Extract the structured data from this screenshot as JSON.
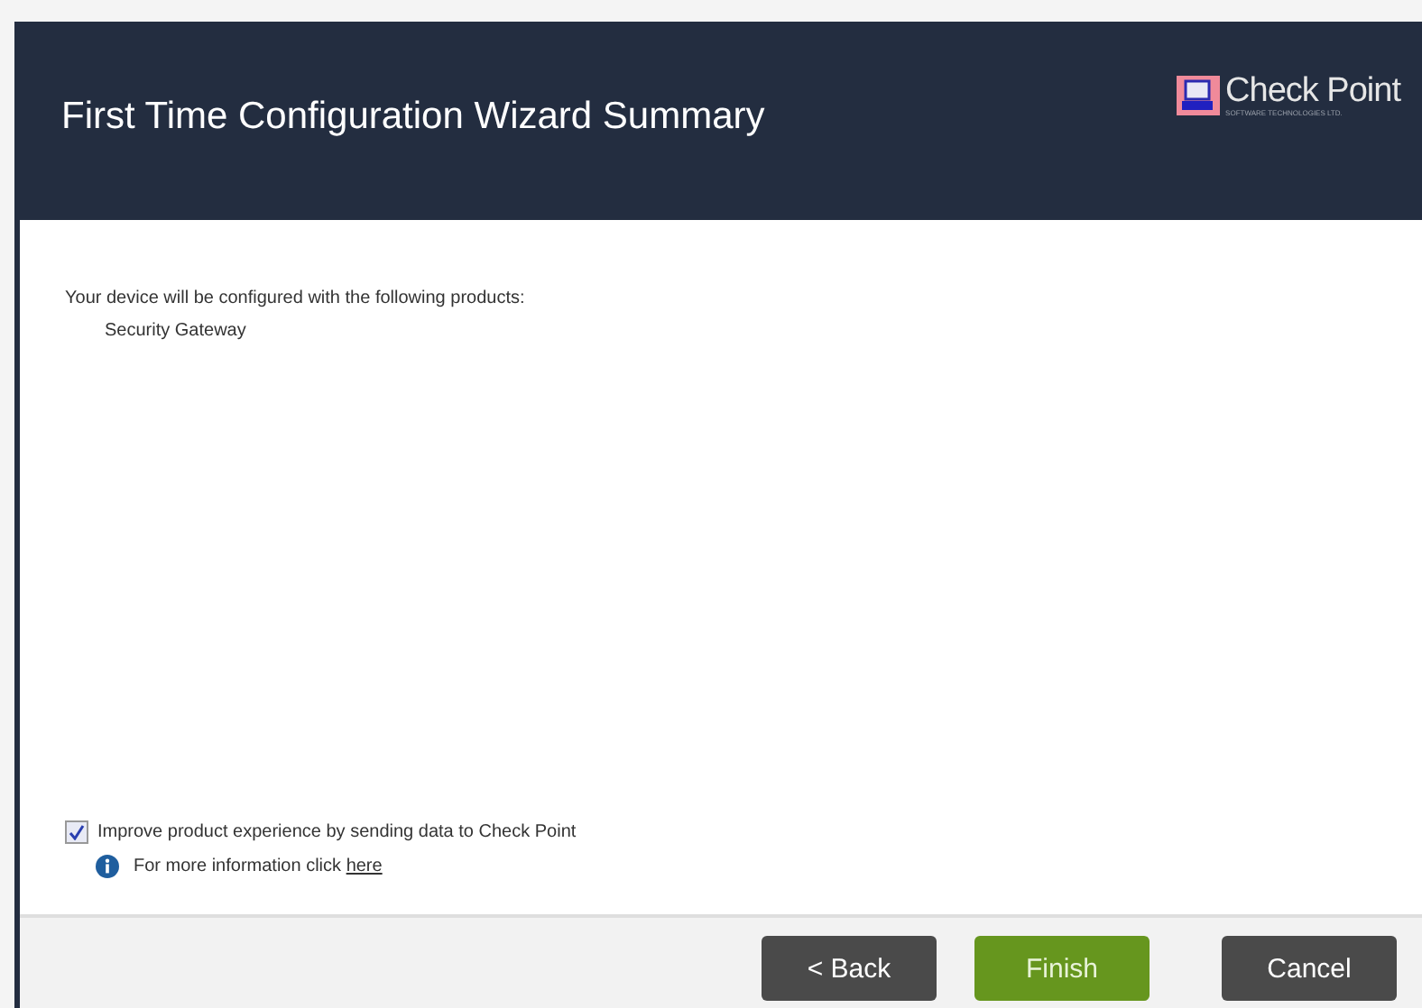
{
  "window": {
    "title": "First Time Configuration Wizard Summary"
  },
  "logo": {
    "name": "Check Point",
    "tagline": "SOFTWARE TECHNOLOGIES LTD."
  },
  "summary": {
    "intro": "Your device will be configured with the following products:",
    "products": [
      "Security Gateway"
    ]
  },
  "consent": {
    "label": "Improve product experience by sending data to Check Point",
    "checked": true
  },
  "info": {
    "text": "For more information click ",
    "link": "here"
  },
  "buttons": [
    {
      "label": "< Back",
      "kind": "secondary"
    },
    {
      "label": "Finish",
      "kind": "primary"
    },
    {
      "label": "Cancel",
      "kind": "secondary"
    }
  ]
}
